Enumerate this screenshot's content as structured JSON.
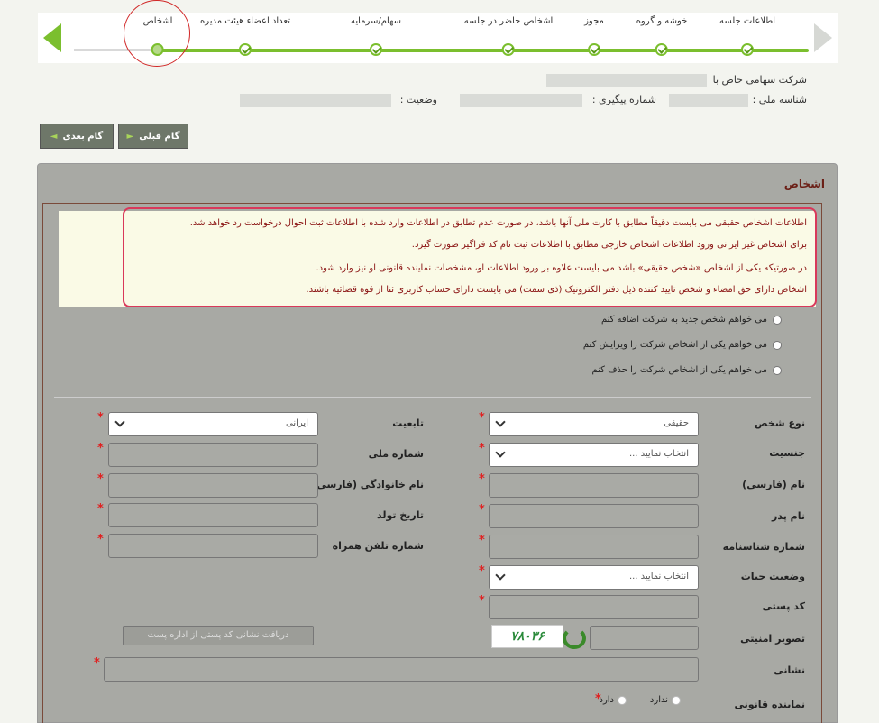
{
  "wizard": {
    "steps": [
      {
        "label": "اطلاعات جلسه"
      },
      {
        "label": "خوشه و گروه"
      },
      {
        "label": "مجوز"
      },
      {
        "label": "اشخاص حاضر در جلسه"
      },
      {
        "label": "سهام/سرمایه"
      },
      {
        "label": "تعداد اعضاء هیئت مدیره"
      },
      {
        "label": "اشخاص"
      }
    ],
    "current_step": "اشخاص"
  },
  "company": {
    "name_label": "شرکت سهامی خاص با",
    "national_id_label": "شناسه ملی :",
    "tracking_label": "شماره پیگیری :",
    "status_label": "وضعیت :"
  },
  "buttons": {
    "prev_step": "گام قبلی",
    "next_step": "گام بعدی",
    "postal_lookup": "دریافت نشانی کد پستی از اداره پست"
  },
  "panel": {
    "title": "اشخاص",
    "notice": [
      "اطلاعات اشخاص حقیقی می بایست دقیقاً مطابق با کارت ملی آنها باشد، در صورت عدم تطابق در اطلاعات وارد شده با اطلاعات ثبت احوال درخواست رد خواهد شد.",
      "برای اشخاص غیر ایرانی ورود اطلاعات اشخاص خارجی مطابق با اطلاعات ثبت نام کد فراگیر صورت گیرد.",
      "در صورتیکه یکی از اشخاص «شخص حقیقی» باشد می بایست علاوه بر ورود اطلاعات او، مشخصات نماینده قانونی او نیز وارد شود.",
      "اشخاص دارای حق امضاء و شخص تایید کننده ذیل دفتر الکترونیک (ذی سمت) می بایست دارای حساب کاربری ثنا از قوه قضائیه باشند."
    ],
    "options": [
      "می خواهم شخص جدید به شرکت اضافه کنم",
      "می خواهم یکی از اشخاص شرکت را ویرایش کنم",
      "می خواهم یکی از اشخاص شرکت را حذف کنم"
    ]
  },
  "form": {
    "person_type": {
      "label": "نوع شخص",
      "value": "حقیقی"
    },
    "nationality": {
      "label": "تابعیت",
      "value": "ایرانی"
    },
    "gender": {
      "label": "جنسیت",
      "placeholder": "انتخاب نمایید ..."
    },
    "national_code": {
      "label": "شماره ملی"
    },
    "first_name": {
      "label": "نام (فارسی)"
    },
    "last_name": {
      "label": "نام خانوادگی (فارسی)"
    },
    "father_name": {
      "label": "نام پدر"
    },
    "birth_date": {
      "label": "تاریخ تولد"
    },
    "id_number": {
      "label": "شماره شناسنامه"
    },
    "mobile": {
      "label": "شماره تلفن همراه"
    },
    "life_status": {
      "label": "وضعیت حیات",
      "placeholder": "انتخاب نمایید ..."
    },
    "postal_code": {
      "label": "کد پستی"
    },
    "captcha": {
      "label": "تصویر امنیتی",
      "image_text": "۷۸۰۳۶"
    },
    "address": {
      "label": "نشانی"
    },
    "legal_rep": {
      "label": "نماینده قانونی",
      "options": [
        "ندارد",
        "دارد"
      ]
    }
  },
  "colors": {
    "accent": "#7bbf2e",
    "notice_text": "#8a1212",
    "required": "#e02020",
    "panel_title": "#6b1f16"
  }
}
